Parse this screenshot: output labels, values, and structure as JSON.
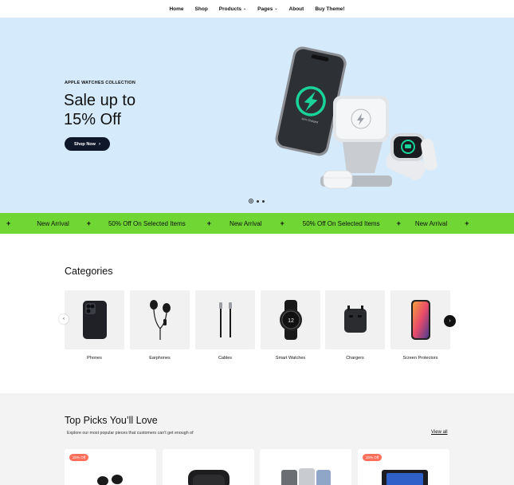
{
  "nav": {
    "items": [
      {
        "label": "Home",
        "dropdown": false
      },
      {
        "label": "Shop",
        "dropdown": false
      },
      {
        "label": "Products",
        "dropdown": true
      },
      {
        "label": "Pages",
        "dropdown": true
      },
      {
        "label": "About",
        "dropdown": false
      },
      {
        "label": "Buy Theme!",
        "dropdown": false
      }
    ]
  },
  "hero": {
    "eyebrow": "APPLE WATCHES COLLECTION",
    "title_line1": "Sale up to",
    "title_line2": "15% Off",
    "button_label": "Shop Now",
    "charger_text": "15% Charged",
    "slides_total": 3,
    "active_slide": 1,
    "background": "#d5eafb"
  },
  "marquee": {
    "background": "#6fd634",
    "items": [
      "New Arrival",
      "50% Off On Selected Items",
      "New Arrival",
      "50% Off On Selected Items",
      "New Arrival"
    ]
  },
  "categories": {
    "title": "Categories",
    "items": [
      {
        "label": "Phones",
        "icon": "phone-icon"
      },
      {
        "label": "Earphones",
        "icon": "earphones-icon"
      },
      {
        "label": "Cables",
        "icon": "cable-icon"
      },
      {
        "label": "Smart Watches",
        "icon": "smartwatch-icon"
      },
      {
        "label": "Chargers",
        "icon": "charger-icon"
      },
      {
        "label": "Screen Protectors",
        "icon": "screen-protector-icon"
      }
    ]
  },
  "picks": {
    "title": "Top Picks You’ll Love",
    "subtitle": "Explore our most popular pieces that customers can't get enough of",
    "view_all": "View all",
    "cards": [
      {
        "badge": "20% Off",
        "icon": "earbuds-icon"
      },
      {
        "badge": "",
        "icon": "headphones-icon"
      },
      {
        "badge": "",
        "icon": "phones-icon"
      },
      {
        "badge": "20% Off",
        "icon": "tablet-icon"
      }
    ],
    "badge_color": "#ff6f5b"
  }
}
